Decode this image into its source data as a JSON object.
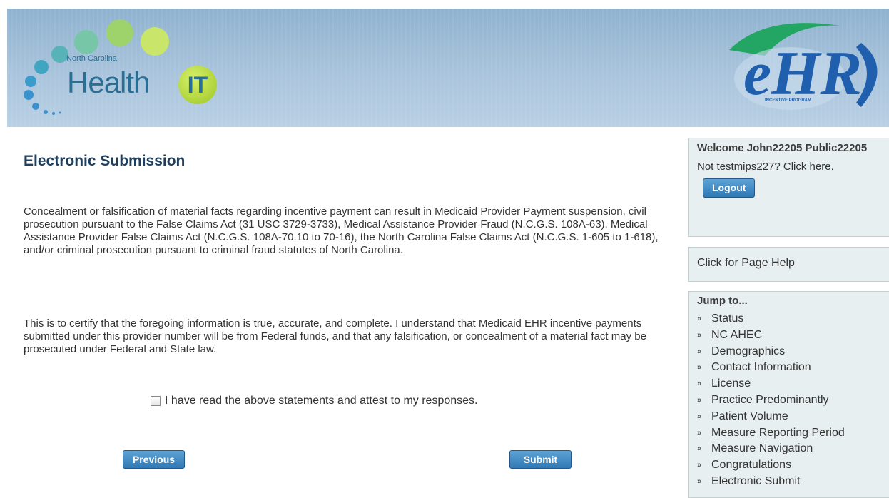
{
  "header": {
    "logo_small_text": "North Carolina",
    "logo_main_text": "Health",
    "logo_it_text": "IT",
    "right_logo_text": "eHR",
    "right_logo_sub": "INCENTIVE PROGRAM"
  },
  "main": {
    "title": "Electronic Submission",
    "paragraph1": "Concealment or falsification of material facts regarding incentive payment can result in Medicaid Provider Payment suspension, civil prosecution pursuant to the False Claims Act (31 USC 3729-3733), Medical Assistance Provider Fraud (N.C.G.S. 108A-63), Medical Assistance Provider False Claims Act (N.C.G.S. 108A-70.10 to 70-16), the North Carolina False Claims Act (N.C.G.S. 1-605 to 1-618), and/or criminal prosecution pursuant to criminal fraud statutes of North Carolina.",
    "paragraph2": "This is to certify that the foregoing information is true, accurate, and complete. I understand that Medicaid EHR incentive payments submitted under this provider number will be from Federal funds, and that any falsification, or concealment of a material fact may be prosecuted under Federal and State law.",
    "attest_label": "I have read the above statements and attest to my responses.",
    "attest_checked": false,
    "previous_label": "Previous",
    "submit_label": "Submit"
  },
  "sidebar": {
    "welcome": "Welcome John22205 Public22205",
    "not_user": "Not testmips227? Click here.",
    "logout_label": "Logout",
    "help_label": "Click for Page Help",
    "jump_title": "Jump to...",
    "jump_items": [
      "Status",
      "NC AHEC",
      "Demographics",
      "Contact Information",
      "License",
      "Practice Predominantly",
      "Patient Volume",
      "Measure Reporting Period",
      "Measure Navigation",
      "Congratulations",
      "Electronic Submit"
    ]
  },
  "colors": {
    "title": "#1f3f5c",
    "button": "#2f79b5",
    "sidebar_bg": "#e8eff0",
    "banner": "#a9c4dc"
  }
}
